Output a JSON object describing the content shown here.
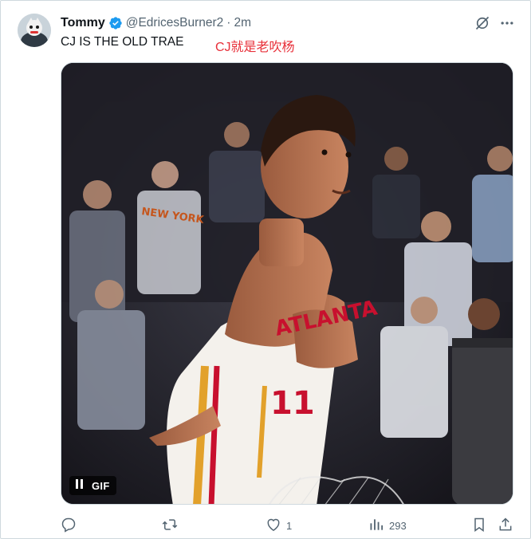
{
  "tweet": {
    "author_name": "Tommy",
    "handle": "@EdricesBurner2",
    "separator": "·",
    "time": "2m",
    "text": "CJ IS THE OLD TRAE",
    "translation_note": "CJ就是老吹杨"
  },
  "media": {
    "type": "gif",
    "gif_label": "GIF",
    "jersey_text": "ATLANTA",
    "jersey_number": "11",
    "crowd_shirt_text": "NEW YORK"
  },
  "actions": {
    "reply_count": "",
    "retweet_count": "",
    "like_count": "1",
    "views_count": "293"
  },
  "colors": {
    "verified_blue": "#1d9bf0",
    "text_primary": "#0f1419",
    "text_secondary": "#536471",
    "annotation_red": "#e8303a"
  },
  "icons": [
    "verified-badge-icon",
    "grok-icon",
    "more-icon",
    "pause-icon",
    "reply-icon",
    "retweet-icon",
    "like-icon",
    "views-icon",
    "bookmark-icon",
    "share-icon"
  ]
}
